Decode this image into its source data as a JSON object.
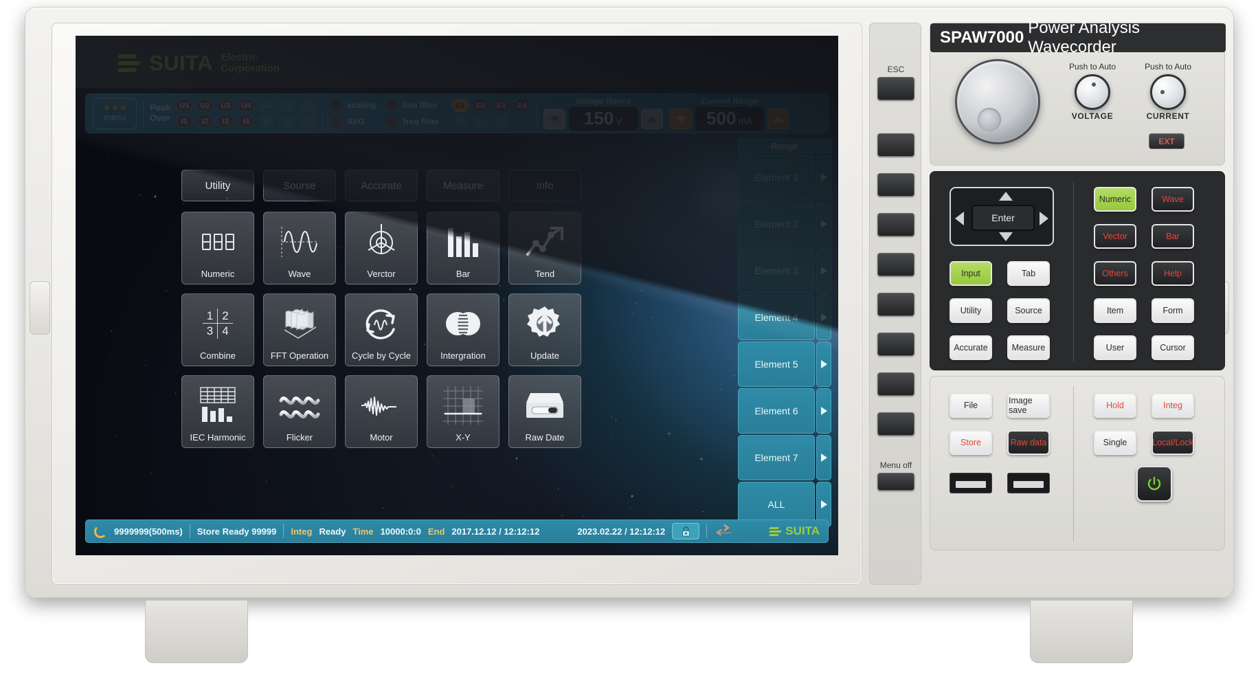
{
  "brand": {
    "name": "SUITA",
    "sub_line1": "Electric",
    "sub_line2": "Corporation",
    "accent": "#9ccc3c"
  },
  "panel": {
    "title_model": "SPAW7000",
    "title_rest": "Power Analysis Wavecorder",
    "knobs": [
      {
        "push_label": "Push to Auto",
        "name": "VOLTAGE"
      },
      {
        "push_label": "Push to Auto",
        "name": "CURRENT"
      }
    ],
    "ext_label": "EXT",
    "nav": {
      "enter": "Enter",
      "up": "▲",
      "down": "▼",
      "left": "◀",
      "right": "▶"
    },
    "keys_left": [
      {
        "label": "Input",
        "style": "green"
      },
      {
        "label": "Tab",
        "style": "light"
      },
      {
        "label": "Utility",
        "style": "light"
      },
      {
        "label": "Source",
        "style": "light"
      },
      {
        "label": "Accurate",
        "style": "light"
      },
      {
        "label": "Measure",
        "style": "light"
      }
    ],
    "keys_right": [
      {
        "label": "Numeric",
        "style": "green"
      },
      {
        "label": "Wave",
        "style": "dark-red"
      },
      {
        "label": "Vector",
        "style": "dark-red"
      },
      {
        "label": "Bar",
        "style": "dark-red"
      },
      {
        "label": "Others",
        "style": "dark-red"
      },
      {
        "label": "Help",
        "style": "dark-red"
      },
      {
        "label": "Item",
        "style": "light"
      },
      {
        "label": "Form",
        "style": "light"
      },
      {
        "label": "User",
        "style": "light"
      },
      {
        "label": "Cursor",
        "style": "light"
      }
    ],
    "keys_file": [
      {
        "label": "File",
        "style": "light"
      },
      {
        "label": "Image save",
        "style": "light"
      },
      {
        "label": "Store",
        "style": "light-red"
      },
      {
        "label": "Raw data",
        "style": "dark-red"
      }
    ],
    "keys_run": [
      {
        "label": "Hold",
        "style": "light-red"
      },
      {
        "label": "Integ",
        "style": "light-red"
      },
      {
        "label": "Single",
        "style": "light"
      },
      {
        "label": "Local/Lock",
        "style": "dark-red"
      }
    ],
    "softkeys": {
      "esc": "ESC",
      "menu_off": "Menu off",
      "count": 8
    }
  },
  "toolbar": {
    "menu_label": "menu",
    "peak_over_line1": "Peak",
    "peak_over_line2": "Over",
    "voltage_chips": [
      {
        "label": "U1",
        "on": true
      },
      {
        "label": "U2",
        "on": true
      },
      {
        "label": "U3",
        "on": true
      },
      {
        "label": "U4",
        "on": true
      },
      {
        "label": "U5",
        "on": false
      },
      {
        "label": "U6",
        "on": false
      },
      {
        "label": "U7",
        "on": false
      }
    ],
    "current_chips": [
      {
        "label": "I1",
        "on": true
      },
      {
        "label": "I2",
        "on": true
      },
      {
        "label": "I3",
        "on": true
      },
      {
        "label": "I4",
        "on": true
      },
      {
        "label": "I5",
        "on": false
      },
      {
        "label": "I6",
        "on": false
      },
      {
        "label": "I7",
        "on": false
      }
    ],
    "filters": [
      "scaling",
      "AVG",
      "line filter",
      "freq filter"
    ],
    "element_chips_row1": [
      {
        "label": "E1",
        "state": "active"
      },
      {
        "label": "E2",
        "state": "on"
      },
      {
        "label": "E3",
        "state": "on"
      },
      {
        "label": "E4",
        "state": "on"
      }
    ],
    "element_chips_row2": [
      {
        "label": "E5",
        "state": "off"
      },
      {
        "label": "E6",
        "state": "off"
      },
      {
        "label": "E7",
        "state": "off"
      }
    ],
    "voltage_range": {
      "caption": "Voltage Rance",
      "value": "150",
      "unit": "V"
    },
    "current_range": {
      "caption": "Current Range",
      "value": "500",
      "unit": "mA"
    }
  },
  "tabs": [
    {
      "label": "Utility",
      "active": false
    },
    {
      "label": "Sourse",
      "active": false
    },
    {
      "label": "Accurate",
      "active": false
    },
    {
      "label": "Measure",
      "active": false
    },
    {
      "label": "Info",
      "active": true
    }
  ],
  "grid": [
    {
      "label": "Numeric",
      "icon": "seven-segment-icon"
    },
    {
      "label": "Wave",
      "icon": "waveform-icon"
    },
    {
      "label": "Verctor",
      "icon": "vector-phasor-icon"
    },
    {
      "label": "Bar",
      "icon": "bar-chart-icon"
    },
    {
      "label": "Tend",
      "icon": "trend-arrow-icon"
    },
    {
      "label": "Combine",
      "icon": "quad-split-icon"
    },
    {
      "label": "FFT Operation",
      "icon": "fft-layers-icon"
    },
    {
      "label": "Cycle by Cycle",
      "icon": "cycle-refresh-icon"
    },
    {
      "label": "Intergration",
      "icon": "integration-venn-icon"
    },
    {
      "label": "Update",
      "icon": "gear-update-icon"
    },
    {
      "label": "IEC Harmonic",
      "icon": "table-bar-icon"
    },
    {
      "label": "Flicker",
      "icon": "flicker-wave-icon"
    },
    {
      "label": "Motor",
      "icon": "motor-signal-icon"
    },
    {
      "label": "X-Y",
      "icon": "xy-plot-icon"
    },
    {
      "label": "Raw Date",
      "icon": "storage-drive-icon"
    }
  ],
  "sidebar": {
    "header": "Range",
    "items": [
      {
        "label": "Element 1"
      },
      {
        "label": "Element 2"
      },
      {
        "label": "Element 3"
      },
      {
        "label": "Element 4"
      },
      {
        "label": "Element 5"
      },
      {
        "label": "Element 6"
      },
      {
        "label": "Element 7"
      },
      {
        "label": "ALL"
      }
    ]
  },
  "status": {
    "sample": "9999999(500ms)",
    "store": "Store Ready 99999",
    "integ_label": "Integ",
    "integ_state": "Ready",
    "time_label": "Time",
    "time_value": "10000:0:0",
    "end_label": "End",
    "end_value": "2017.12.12 / 12:12:12",
    "clock": "2023.02.22 / 12:12:12",
    "lock_icon": "lock-icon",
    "sync_icon": "transfer-arrows-icon",
    "brand": "SUITA"
  }
}
